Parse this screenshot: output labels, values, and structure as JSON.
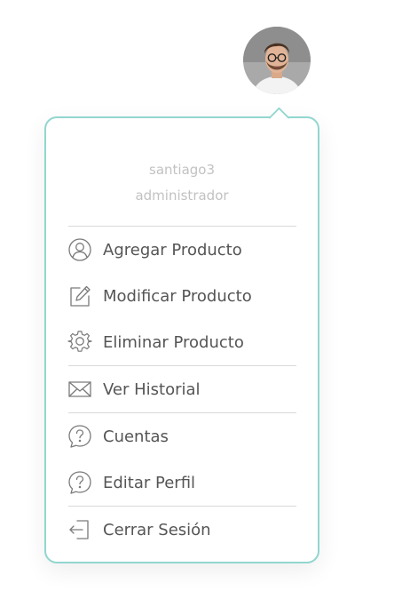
{
  "user": {
    "username": "santiago3",
    "role": "administrador"
  },
  "menu": {
    "items": [
      {
        "label": "Agregar Producto",
        "icon": "user-circle-icon"
      },
      {
        "label": "Modificar Producto",
        "icon": "edit-icon"
      },
      {
        "label": "Eliminar Producto",
        "icon": "gear-icon"
      },
      {
        "label": "Ver Historial",
        "icon": "envelope-icon"
      },
      {
        "label": "Cuentas",
        "icon": "help-bubble-icon"
      },
      {
        "label": "Editar Perfil",
        "icon": "help-bubble-icon"
      },
      {
        "label": "Cerrar Sesión",
        "icon": "logout-icon"
      }
    ]
  },
  "colors": {
    "border": "#92d6cf",
    "text": "#555555",
    "muted_text": "#c2c2c2",
    "icon": "#7a7a7a"
  }
}
